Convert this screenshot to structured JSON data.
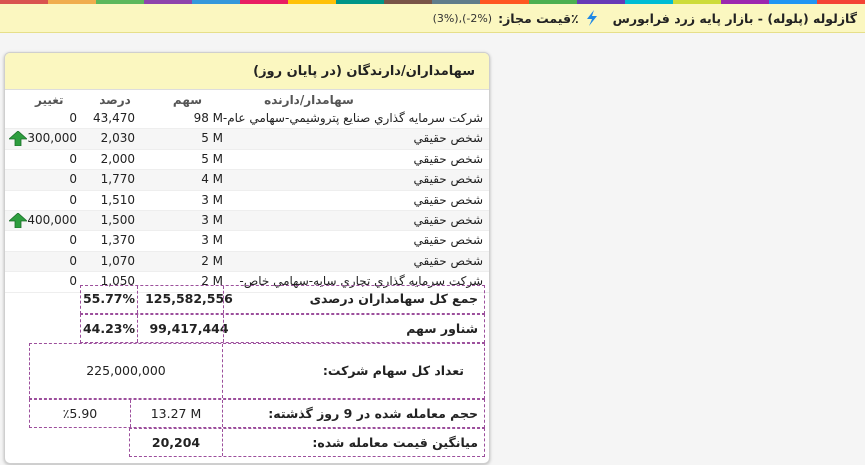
{
  "header": {
    "stripe_colors": [
      "#d9534f",
      "#f0ad4e",
      "#5cb85c",
      "#8e44ad",
      "#3498db",
      "#e91e63",
      "#ffc107",
      "#009688",
      "#795548",
      "#607d8b",
      "#ff5722",
      "#4caf50",
      "#673ab7",
      "#00bcd4",
      "#cddc39",
      "#9c27b0",
      "#2196f3",
      "#f44336"
    ],
    "symbol_title": "گازلوله (پلوله) - بازار پایه زرد فرابورس",
    "price_limit_label": "٪قیمت مجاز:",
    "price_limit_value": "(3%),(-2%)"
  },
  "panel": {
    "title": "سهامداران/دارندگان (در پایان روز)",
    "columns": {
      "holder": "سهامدار/دارنده",
      "shares": "سهم",
      "percent": "درصد",
      "change": "تغییر"
    },
    "rows": [
      {
        "holder": "شرکت سرمايه گذاري صنايع پتروشيمي-سهامي عام-",
        "shares": "98 M",
        "percent": "43,470",
        "change": "0",
        "up": false
      },
      {
        "holder": "شخص حقيقي",
        "shares": "5 M",
        "percent": "2,030",
        "change": "300,000",
        "up": true
      },
      {
        "holder": "شخص حقيقي",
        "shares": "5 M",
        "percent": "2,000",
        "change": "0",
        "up": false
      },
      {
        "holder": "شخص حقيقي",
        "shares": "4 M",
        "percent": "1,770",
        "change": "0",
        "up": false
      },
      {
        "holder": "شخص حقيقي",
        "shares": "3 M",
        "percent": "1,510",
        "change": "0",
        "up": false
      },
      {
        "holder": "شخص حقيقي",
        "shares": "3 M",
        "percent": "1,500",
        "change": "400,000",
        "up": true
      },
      {
        "holder": "شخص حقيقي",
        "shares": "3 M",
        "percent": "1,370",
        "change": "0",
        "up": false
      },
      {
        "holder": "شخص حقيقي",
        "shares": "2 M",
        "percent": "1,070",
        "change": "0",
        "up": false
      },
      {
        "holder": "شرکت سرمايه گذاري تجاري سايه-سهامي خاص-",
        "shares": "2 M",
        "percent": "1,050",
        "change": "0",
        "up": false
      }
    ],
    "total_holders": {
      "label": "جمع کل سهامداران درصدی",
      "shares": "125,582,556",
      "percent": "55.77%"
    },
    "float": {
      "label": "شناور سهم",
      "shares": "99,417,444",
      "percent": "44.23%"
    },
    "total_shares": {
      "label": "تعداد کل سهام شرکت:",
      "value": "225,000,000"
    },
    "volume_9d": {
      "label": "حجم معامله شده در 9 روز گذشته:",
      "value": "13.27 M",
      "percent": "٪5.90"
    },
    "avg_price": {
      "label": "میانگین قیمت معامله شده:",
      "value": "20,204"
    }
  }
}
